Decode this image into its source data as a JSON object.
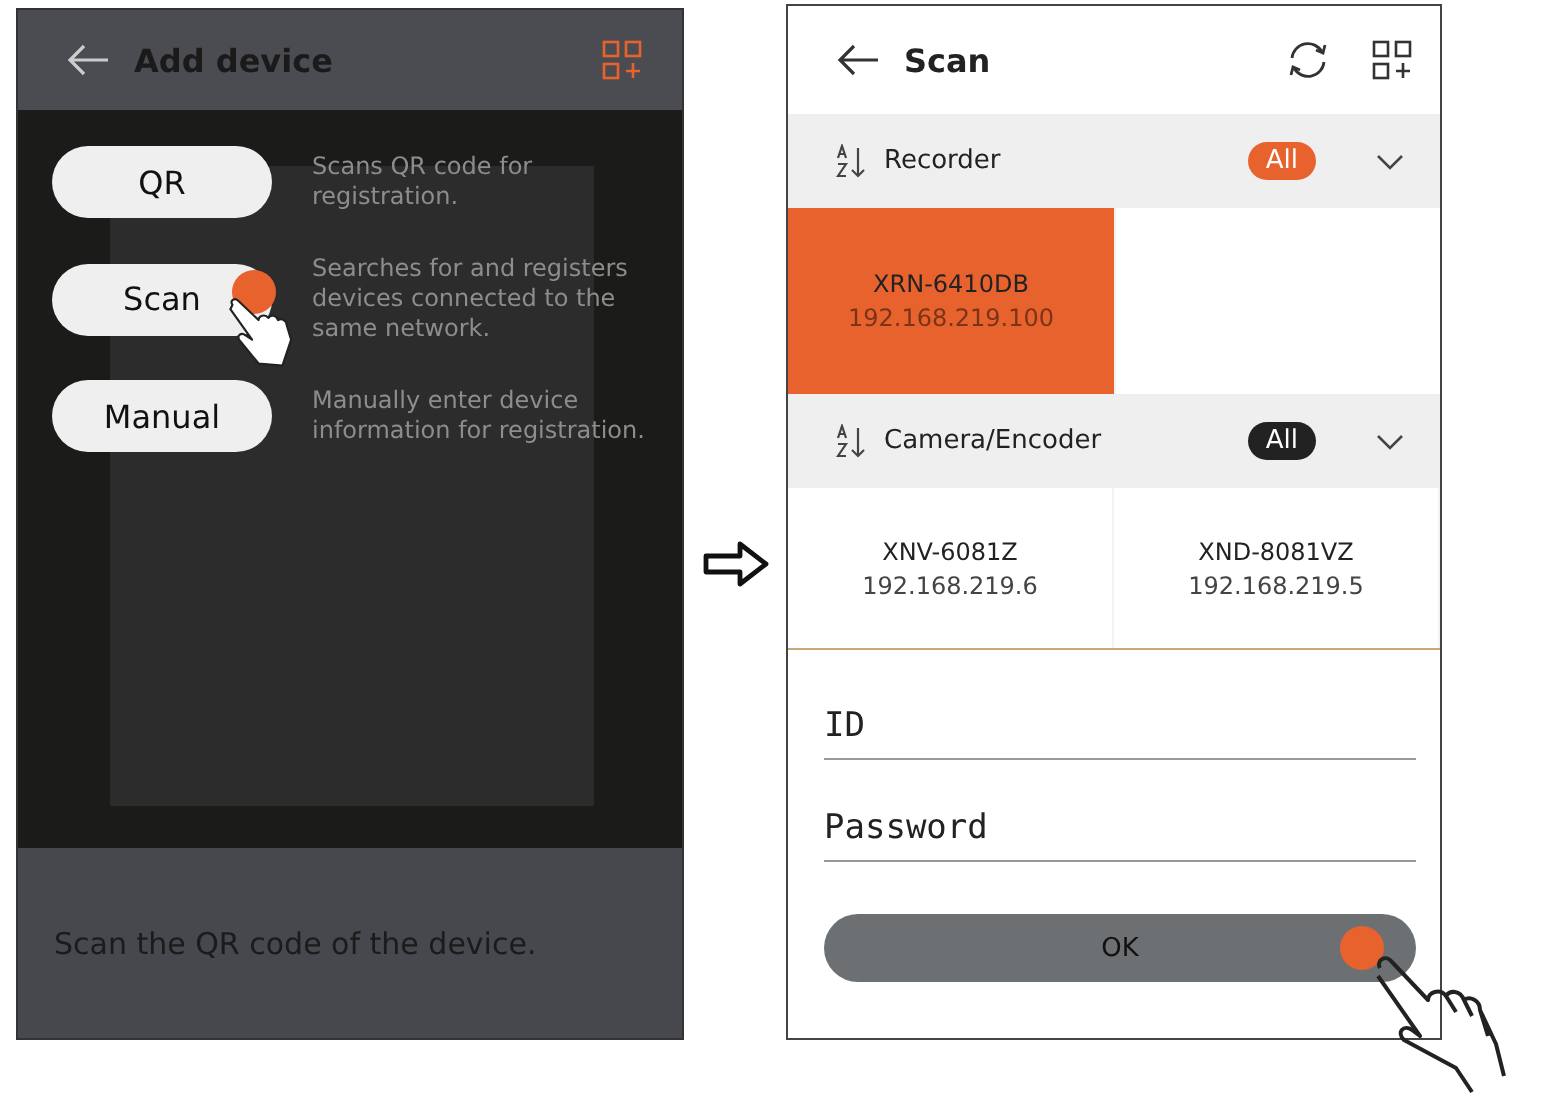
{
  "add_device_screen": {
    "title": "Add device",
    "options": [
      {
        "label": "QR",
        "description": "Scans QR code for registration.",
        "pressed": false
      },
      {
        "label": "Scan",
        "description": "Searches for and registers devices connected to the same network.",
        "pressed": true
      },
      {
        "label": "Manual",
        "description": "Manually enter device information for registration.",
        "pressed": false
      }
    ],
    "hint": "Scan the QR code of the device."
  },
  "scan_screen": {
    "title": "Scan",
    "groups": [
      {
        "name": "Recorder",
        "filter": "All",
        "filter_active": true,
        "devices": [
          {
            "model": "XRN-6410DB",
            "ip": "192.168.219.100",
            "selected": true
          }
        ]
      },
      {
        "name": "Camera/Encoder",
        "filter": "All",
        "filter_active": false,
        "devices": [
          {
            "model": "XNV-6081Z",
            "ip": "192.168.219.6",
            "selected": false
          },
          {
            "model": "XND-8081VZ",
            "ip": "192.168.219.5",
            "selected": false
          }
        ]
      }
    ],
    "fields": [
      {
        "placeholder": "ID"
      },
      {
        "placeholder": "Password"
      }
    ],
    "ok_button": {
      "label": "OK",
      "pressed": true
    }
  }
}
